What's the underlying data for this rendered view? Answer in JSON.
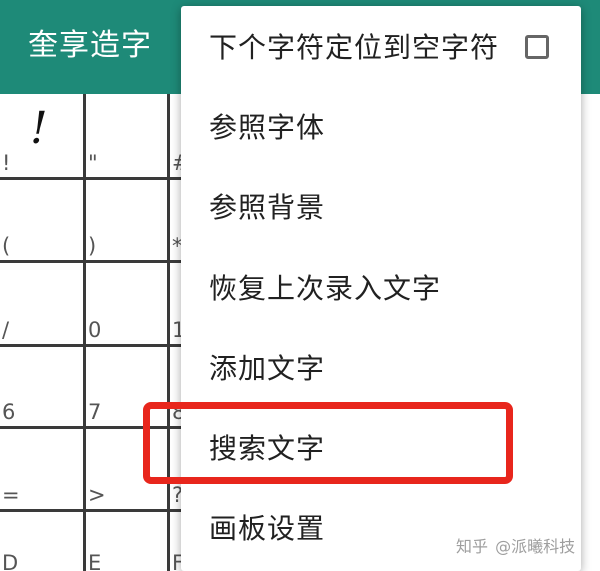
{
  "appbar": {
    "title": "奎享造字",
    "color": "#1e8a78"
  },
  "grid": {
    "glyph": "!",
    "rows": [
      [
        "!",
        "\"",
        "#"
      ],
      [
        "(",
        ")",
        "*"
      ],
      [
        "/",
        "0",
        "1"
      ],
      [
        "6",
        "7",
        "8"
      ],
      [
        "=",
        ">",
        "?"
      ],
      [
        "D",
        "E",
        "F"
      ]
    ]
  },
  "menu": {
    "items": [
      {
        "label": "下个字符定位到空字符",
        "checkbox": true,
        "checked": false
      },
      {
        "label": "参照字体"
      },
      {
        "label": "参照背景"
      },
      {
        "label": "恢复上次录入文字"
      },
      {
        "label": "添加文字"
      },
      {
        "label": "搜索文字",
        "highlighted": true,
        "highlight_color": "#e8261c"
      },
      {
        "label": "画板设置"
      }
    ]
  },
  "watermark": {
    "site": "知乎",
    "author": "@派曦科技"
  }
}
